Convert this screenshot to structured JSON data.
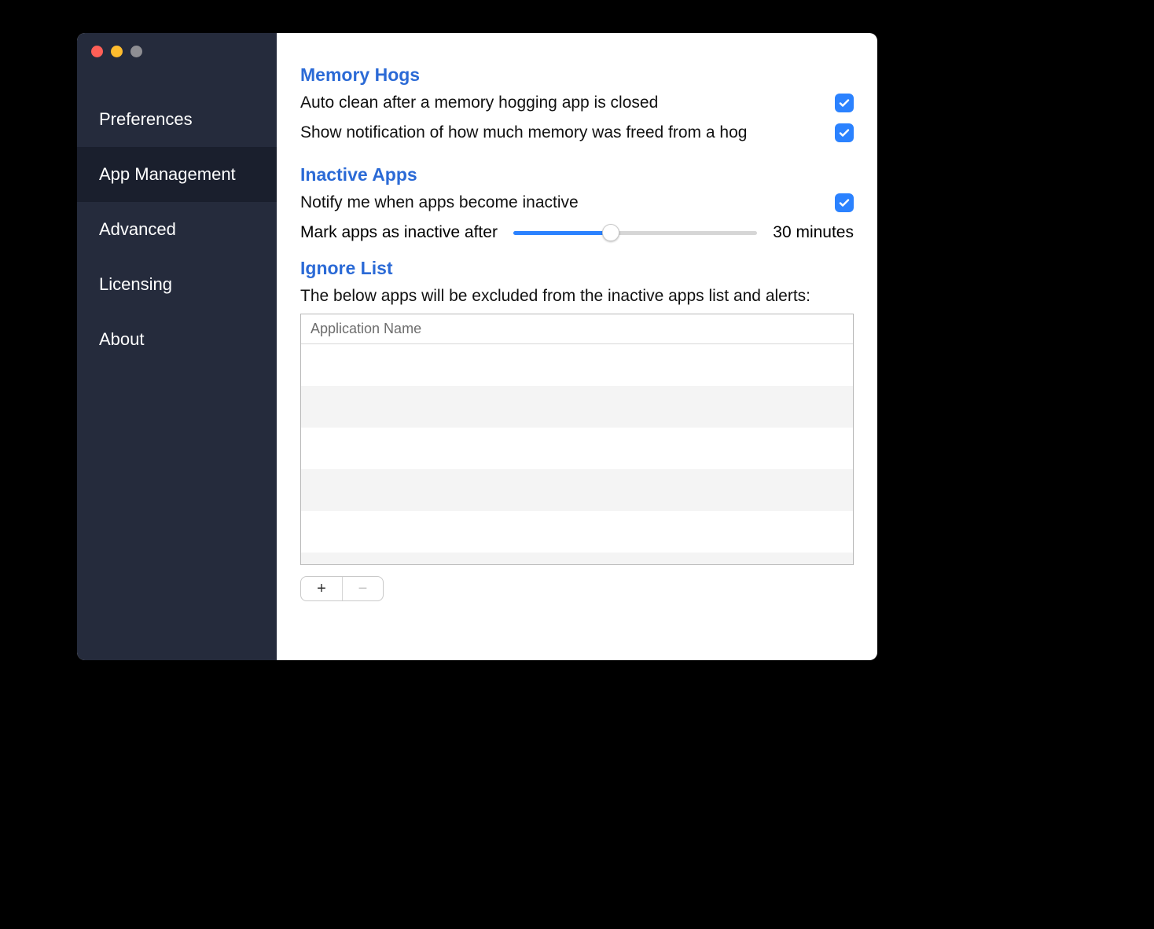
{
  "sidebar": {
    "items": [
      {
        "label": "Preferences"
      },
      {
        "label": "App Management"
      },
      {
        "label": "Advanced"
      },
      {
        "label": "Licensing"
      },
      {
        "label": "About"
      }
    ],
    "active_index": 1
  },
  "sections": {
    "memory_hogs": {
      "title": "Memory Hogs",
      "auto_clean_label": "Auto clean after a memory hogging app is closed",
      "auto_clean_checked": true,
      "notify_label": "Show notification of how much memory was freed from a hog",
      "notify_checked": true
    },
    "inactive_apps": {
      "title": "Inactive Apps",
      "notify_label": "Notify me when apps become inactive",
      "notify_checked": true,
      "slider_label": "Mark apps as inactive after",
      "slider_value_label": "30 minutes",
      "slider_percent": 40
    },
    "ignore_list": {
      "title": "Ignore List",
      "description": "The below apps will be excluded from the inactive apps list and alerts:",
      "column_header": "Application Name",
      "rows": [],
      "add_label": "+",
      "remove_label": "−"
    }
  },
  "colors": {
    "accent": "#2b82ff",
    "heading": "#2b6ad6"
  }
}
